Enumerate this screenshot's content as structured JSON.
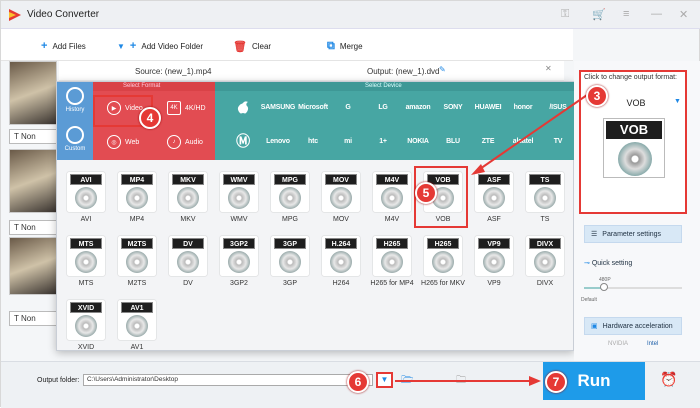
{
  "app": {
    "title": "Video Converter"
  },
  "toolbar": {
    "add_files": "Add Files",
    "add_video_folder": "Add Video Folder",
    "clear": "Clear",
    "merge": "Merge"
  },
  "file": {
    "source": "Source: (new_1).mp4",
    "output": "Output: (new_1).dvd",
    "thumb_label": "Non"
  },
  "nav": {
    "history": "History",
    "custom": "Custom"
  },
  "format_header": "Select Format",
  "device_header": "Select Device",
  "categories": [
    {
      "label": "Video",
      "icon": "play-icon"
    },
    {
      "label": "4K/HD",
      "icon": "4k-icon"
    },
    {
      "label": "Web",
      "icon": "web-icon"
    },
    {
      "label": "Audio",
      "icon": "audio-icon"
    }
  ],
  "brands_row1": [
    "",
    "SAMSUNG",
    "Microsoft",
    "G",
    "LG",
    "amazon",
    "SONY",
    "HUAWEI",
    "honor",
    "/ISUS"
  ],
  "brands_row2": [
    "",
    "Lenovo",
    "htc",
    "mi",
    "1+",
    "NOKIA",
    "BLU",
    "ZTE",
    "alcatel",
    "TV"
  ],
  "formats": [
    {
      "tag": "AVI",
      "label": "AVI"
    },
    {
      "tag": "MP4",
      "label": "MP4"
    },
    {
      "tag": "MKV",
      "label": "MKV"
    },
    {
      "tag": "WMV",
      "label": "WMV"
    },
    {
      "tag": "MPG",
      "label": "MPG"
    },
    {
      "tag": "MOV",
      "label": "MOV"
    },
    {
      "tag": "M4V",
      "label": "M4V"
    },
    {
      "tag": "VOB",
      "label": "VOB"
    },
    {
      "tag": "ASF",
      "label": "ASF"
    },
    {
      "tag": "TS",
      "label": "TS"
    },
    {
      "tag": "MTS",
      "label": "MTS"
    },
    {
      "tag": "M2TS",
      "label": "M2TS"
    },
    {
      "tag": "DV",
      "label": "DV"
    },
    {
      "tag": "3GP2",
      "label": "3GP2"
    },
    {
      "tag": "3GP",
      "label": "3GP"
    },
    {
      "tag": "H.264",
      "label": "H264"
    },
    {
      "tag": "H265",
      "label": "H265 for MP4"
    },
    {
      "tag": "H265",
      "label": "H265 for MKV"
    },
    {
      "tag": "VP9",
      "label": "VP9"
    },
    {
      "tag": "DIVX",
      "label": "DIVX"
    },
    {
      "tag": "XVID",
      "label": "XVID"
    },
    {
      "tag": "AV1",
      "label": "AV1"
    }
  ],
  "output_panel": {
    "hint": "Click to change output format:",
    "format": "VOB",
    "big_tag": "VOB",
    "parameter_settings": "Parameter settings",
    "quick_setting": "Quick setting",
    "quality_label": "480P",
    "default_label": "Default",
    "hardware_acceleration": "Hardware acceleration",
    "nvidia": "NVIDIA",
    "intel": "Intel"
  },
  "bottom": {
    "output_folder_label": "Output folder:",
    "output_folder_value": "C:\\Users\\Administrator\\Desktop",
    "run": "Run"
  },
  "badges": [
    "3",
    "4",
    "5",
    "6",
    "7"
  ]
}
